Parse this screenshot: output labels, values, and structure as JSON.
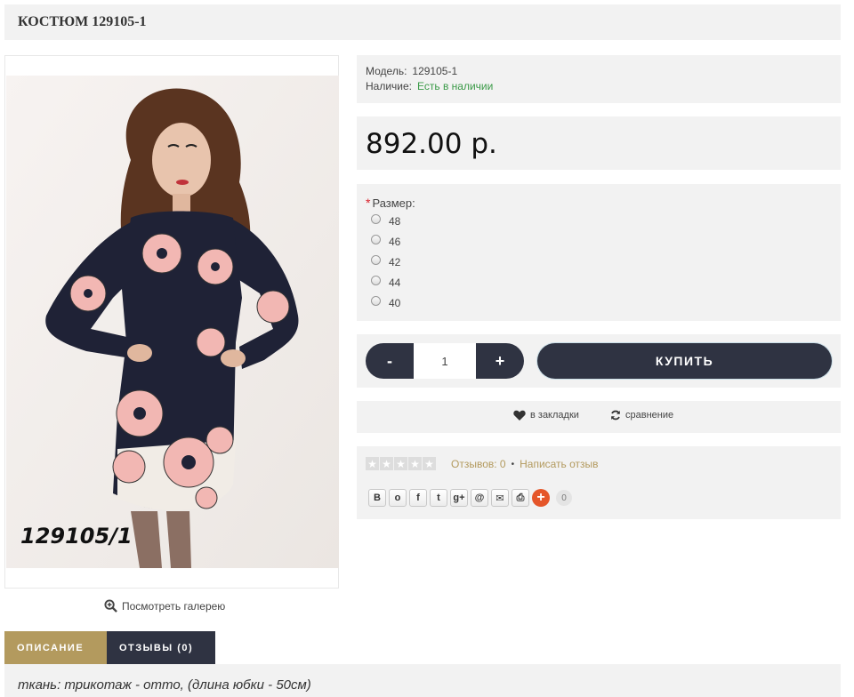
{
  "product": {
    "title": "КОСТЮМ 129105-1",
    "image_caption": "129105/1",
    "gallery_link": "Посмотреть галерею"
  },
  "info": {
    "model_label": "Модель:",
    "model_value": "129105-1",
    "stock_label": "Наличие:",
    "stock_value": "Есть в наличии"
  },
  "price": "892.00 р.",
  "size": {
    "label": "Размер:",
    "required_mark": "*",
    "options": [
      "48",
      "46",
      "42",
      "44",
      "40"
    ]
  },
  "buy": {
    "minus_label": "-",
    "quantity": "1",
    "plus_label": "+",
    "buy_label": "КУПИТЬ"
  },
  "links": {
    "wishlist": "в закладки",
    "compare": "сравнение"
  },
  "reviews": {
    "rating": 0,
    "reviews_count": "Отзывов: 0",
    "separator": "•",
    "write_review": "Написать отзыв"
  },
  "share": {
    "buttons": [
      "В",
      "о",
      "f",
      "t",
      "g+",
      "@",
      "✉",
      "⎙"
    ],
    "count": "0"
  },
  "tabs": {
    "description": "ОПИСАНИЕ",
    "reviews": "ОТЗЫВЫ (0)"
  },
  "description": "ткань: трикотаж - отто,  (длина юбки - 50см)",
  "colors": {
    "accent": "#b39a5e",
    "dark": "#2f3342",
    "in_stock": "#3a9a47",
    "panel_bg": "#f2f2f2"
  }
}
